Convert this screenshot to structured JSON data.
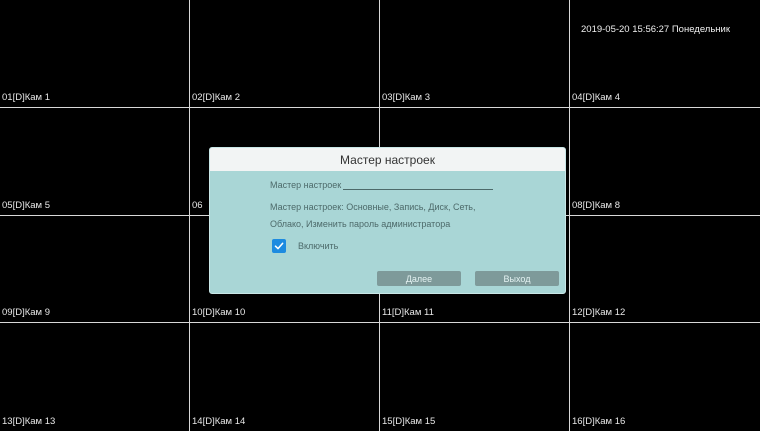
{
  "clock": "2019-05-20 15:56:27 Понедельник",
  "cameras": [
    "01[D]Кам 1",
    "02[D]Кам 2",
    "03[D]Кам 3",
    "04[D]Кам 4",
    "05[D]Кам 5",
    "06",
    "",
    "08[D]Кам 8",
    "09[D]Кам 9",
    "10[D]Кам 10",
    "11[D]Кам 11",
    "12[D]Кам 12",
    "13[D]Кам 13",
    "14[D]Кам 14",
    "15[D]Кам 15",
    "16[D]Кам 16"
  ],
  "wizard": {
    "title": "Мастер настроек",
    "heading": "Мастер настроек",
    "description": "Мастер настроек: Основные, Запись, Диск, Сеть, Облако, Изменить пароль администратора",
    "enable_label": "Включить",
    "enable_checked": true,
    "next_label": "Далее",
    "exit_label": "Выход"
  },
  "colors": {
    "checkbox": "#1d8be0",
    "dialog_bg": "#a9d6d6",
    "button_bg": "#7e9a9a"
  }
}
